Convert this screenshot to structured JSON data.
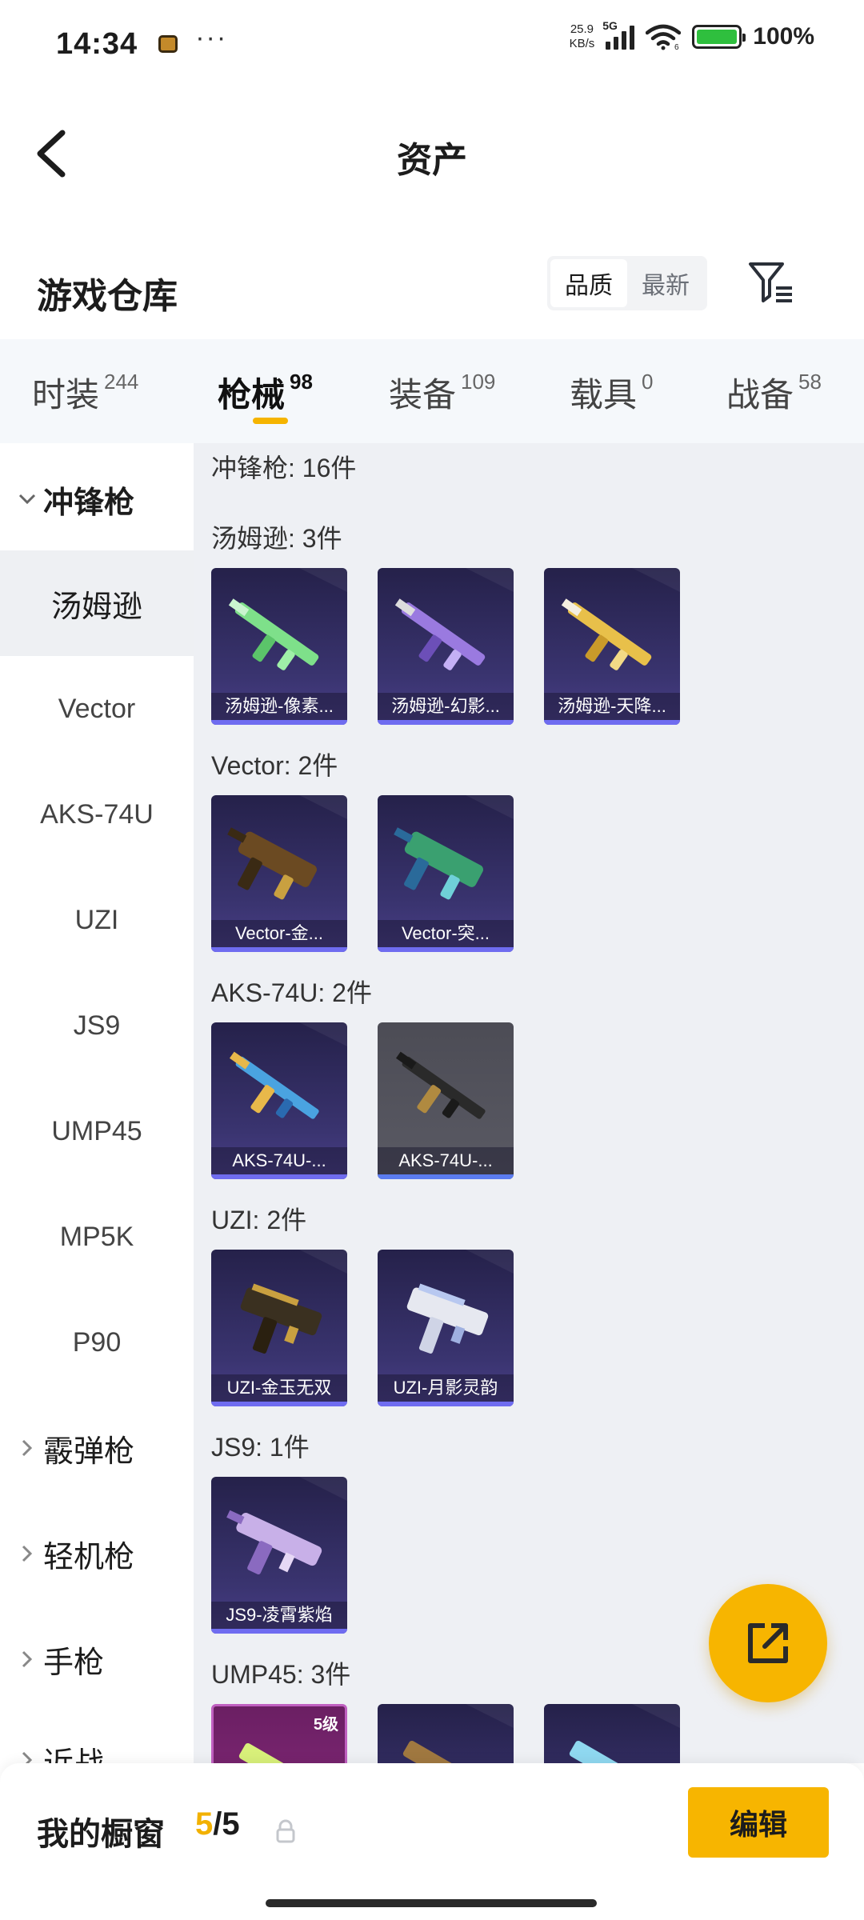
{
  "status_bar": {
    "time": "14:34",
    "dots": "···",
    "net_speed_value": "25.9",
    "net_speed_unit": "KB/s",
    "network": "5G",
    "wifi_sub": "6",
    "battery": "100%",
    "icons": [
      "app-notification-icon",
      "signal-icon",
      "wifi-icon",
      "battery-charging-icon"
    ]
  },
  "header": {
    "title": "资产",
    "back_icon": "chevron-left-icon"
  },
  "warehouse": {
    "title": "游戏仓库",
    "sort_options": [
      "品质",
      "最新"
    ],
    "sort_selected": "品质",
    "filter_icon": "filter-icon"
  },
  "category_tabs": [
    {
      "name": "时装",
      "count": "244"
    },
    {
      "name": "枪械",
      "count": "98"
    },
    {
      "name": "装备",
      "count": "109"
    },
    {
      "name": "载具",
      "count": "0"
    },
    {
      "name": "战备",
      "count": "58"
    }
  ],
  "active_tab": "枪械",
  "sidebar": {
    "groups": [
      "冲锋枪",
      "霰弹枪",
      "轻机枪",
      "手枪",
      "近战"
    ],
    "expanded_group": "冲锋枪",
    "sub_items": [
      "汤姆逊",
      "Vector",
      "AKS-74U",
      "UZI",
      "JS9",
      "UMP45",
      "MP5K",
      "P90"
    ],
    "selected_item": "汤姆逊"
  },
  "content": {
    "summary": "冲锋枪: 16件",
    "sections": [
      {
        "title": "汤姆逊: 3件",
        "items": [
          "汤姆逊-像素...",
          "汤姆逊-幻影...",
          "汤姆逊-天降..."
        ]
      },
      {
        "title": "Vector: 2件",
        "items": [
          "Vector-金...",
          "Vector-突..."
        ]
      },
      {
        "title": "AKS-74U: 2件",
        "items": [
          "AKS-74U-...",
          "AKS-74U-..."
        ]
      },
      {
        "title": "UZI: 2件",
        "items": [
          "UZI-金玉无双",
          "UZI-月影灵韵"
        ]
      },
      {
        "title": "JS9: 1件",
        "items": [
          "JS9-凌霄紫焰"
        ]
      },
      {
        "title": "UMP45: 3件",
        "items": [
          "",
          "",
          ""
        ],
        "first_level": "5级"
      }
    ]
  },
  "bottom": {
    "shelf_label": "我的橱窗",
    "shelf_current": "5",
    "shelf_sep": "/",
    "shelf_max": "5",
    "edit_label": "编辑",
    "share_icon": "share-external-icon",
    "lock_icon": "lock-icon"
  },
  "colors": {
    "accent": "#f7b500",
    "card_bg": "#2e2a5c",
    "card_bar": "#6f6cf0",
    "content_bg": "#eef0f4"
  }
}
